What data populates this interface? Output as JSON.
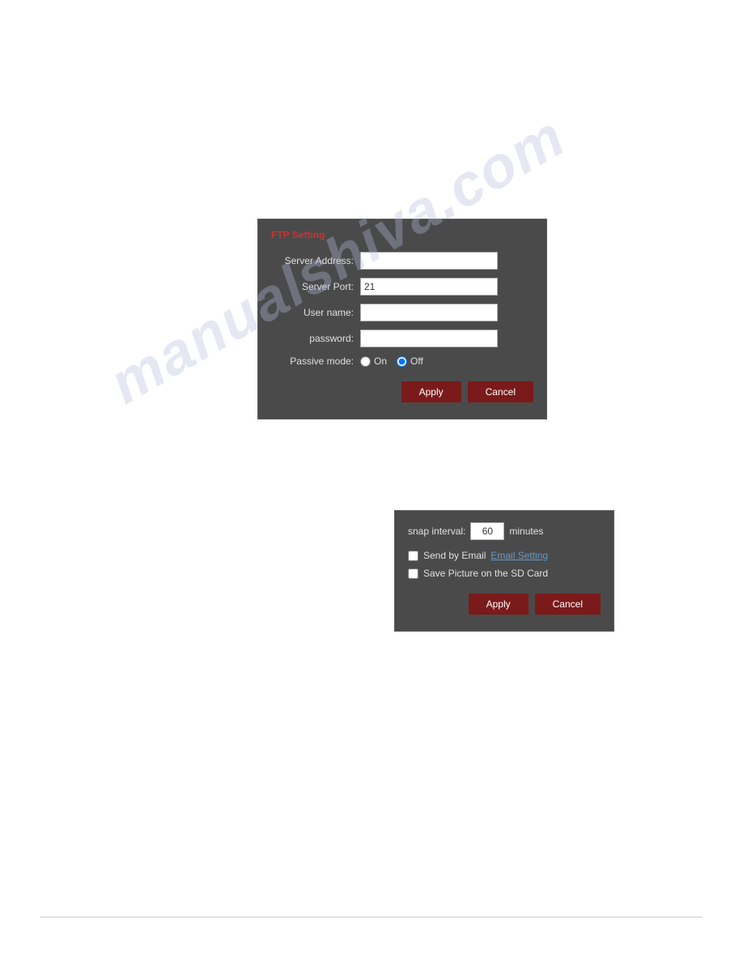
{
  "watermark": {
    "line1": "manualshiva.com"
  },
  "ftp_dialog": {
    "title": "FTP Setting",
    "server_address_label": "Server Address:",
    "server_address_value": "",
    "server_port_label": "Server Port:",
    "server_port_value": "21",
    "username_label": "User name:",
    "username_value": "",
    "password_label": "password:",
    "password_value": "",
    "passive_mode_label": "Passive mode:",
    "passive_on_label": "On",
    "passive_off_label": "Off",
    "apply_label": "Apply",
    "cancel_label": "Cancel"
  },
  "snap_dialog": {
    "snap_interval_label": "snap interval:",
    "snap_interval_value": "60",
    "snap_interval_unit": "minutes",
    "send_by_email_label": "Send by Email",
    "email_setting_label": "Email Setting",
    "save_picture_label": "Save Picture on the SD Card",
    "apply_label": "Apply",
    "cancel_label": "Cancel"
  }
}
